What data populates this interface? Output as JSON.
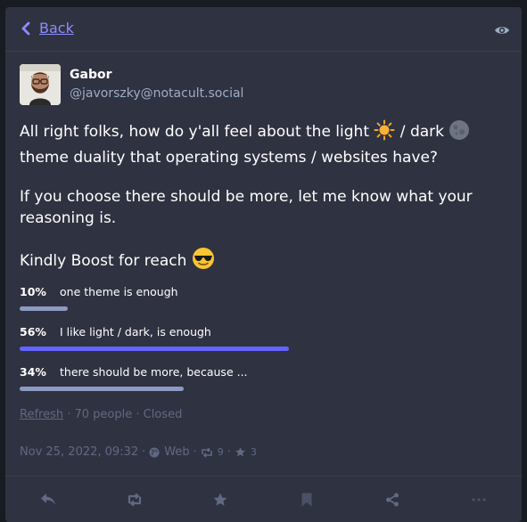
{
  "header": {
    "back_label": "Back"
  },
  "author": {
    "display_name": "Gabor",
    "handle": "@javorszky@notacult.social"
  },
  "post": {
    "line1_text": "All right folks, how do y'all feel about the light",
    "line1_mid": " / dark",
    "line1_end": " theme duality that operating systems / websites have?",
    "paragraph2": "If you choose there should be more, let me know what your reasoning is.",
    "paragraph3": "Kindly Boost for reach",
    "emojis": [
      "sun-emoji",
      "moon-emoji",
      "sunglasses-emoji"
    ]
  },
  "poll": {
    "options": [
      {
        "percent": "10%",
        "label": "one theme is enough",
        "value": 10
      },
      {
        "percent": "56%",
        "label": "I like light / dark, is enough",
        "value": 56,
        "leading": true
      },
      {
        "percent": "34%",
        "label": "there should be more, because ...",
        "value": 34
      }
    ],
    "refresh_label": "Refresh",
    "voters": "70 people",
    "status": "Closed"
  },
  "meta": {
    "timestamp": "Nov 25, 2022, 09:32",
    "visibility_icon": "globe-icon",
    "client": "Web",
    "boosts": "9",
    "favourites": "3"
  },
  "actions": [
    "reply",
    "boost",
    "favourite",
    "bookmark",
    "share",
    "more"
  ],
  "colors": {
    "background": "#191b22",
    "panel": "#2f3240",
    "accent": "#8c8dff",
    "leading_bar": "#6364ff",
    "bar": "#8d9ac2",
    "muted": "#606984",
    "handle": "#9baec8"
  }
}
